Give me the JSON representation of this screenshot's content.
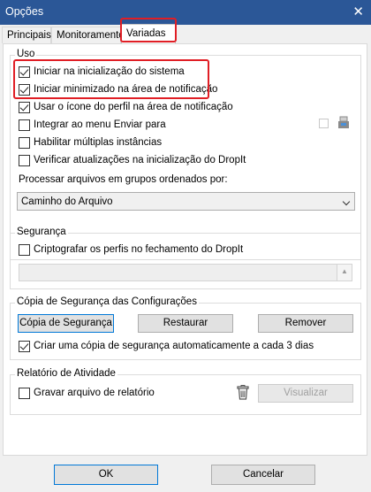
{
  "window": {
    "title": "Opções",
    "close_glyph": "✕"
  },
  "tabs": [
    {
      "label": "Principais"
    },
    {
      "label": "Monitoramento"
    },
    {
      "label": "Variadas",
      "active": true
    }
  ],
  "uso": {
    "legend": "Uso",
    "options": [
      {
        "label": "Iniciar na inicialização do sistema",
        "checked": true
      },
      {
        "label": "Iniciar minimizado na área de notificação",
        "checked": true
      },
      {
        "label": "Usar o ícone do perfil na área de notificação",
        "checked": true
      },
      {
        "label": "Integrar ao menu Enviar para",
        "checked": false
      },
      {
        "label": "Habilitar múltiplas instâncias",
        "checked": false
      },
      {
        "label": "Verificar atualizações na inicialização do DropIt",
        "checked": false
      }
    ],
    "process_label": "Processar arquivos em grupos ordenados por:",
    "process_value": "Caminho do Arquivo"
  },
  "seguranca": {
    "legend": "Segurança",
    "encrypt_label": "Criptografar os perfis no fechamento do DropIt",
    "encrypt_checked": false
  },
  "backup": {
    "legend": "Cópia de Segurança das Configurações",
    "backup_button": "Cópia de Segurança",
    "restore_button": "Restaurar",
    "remove_button": "Remover",
    "auto_label": "Criar uma cópia de segurança automaticamente a cada 3 dias",
    "auto_checked": true
  },
  "atividade": {
    "legend": "Relatório de Atividade",
    "log_label": "Gravar arquivo de relatório",
    "log_checked": false,
    "view_button": "Visualizar"
  },
  "footer": {
    "ok_label": "OK",
    "cancel_label": "Cancelar"
  },
  "colors": {
    "titlebar": "#2b5797",
    "highlight": "#e01e25",
    "focus": "#0078d7"
  },
  "icons": [
    "close-icon",
    "checkbox-icon",
    "usb-drive-icon",
    "trash-icon",
    "dropdown-arrow-icon",
    "spin-arrow-icon"
  ]
}
